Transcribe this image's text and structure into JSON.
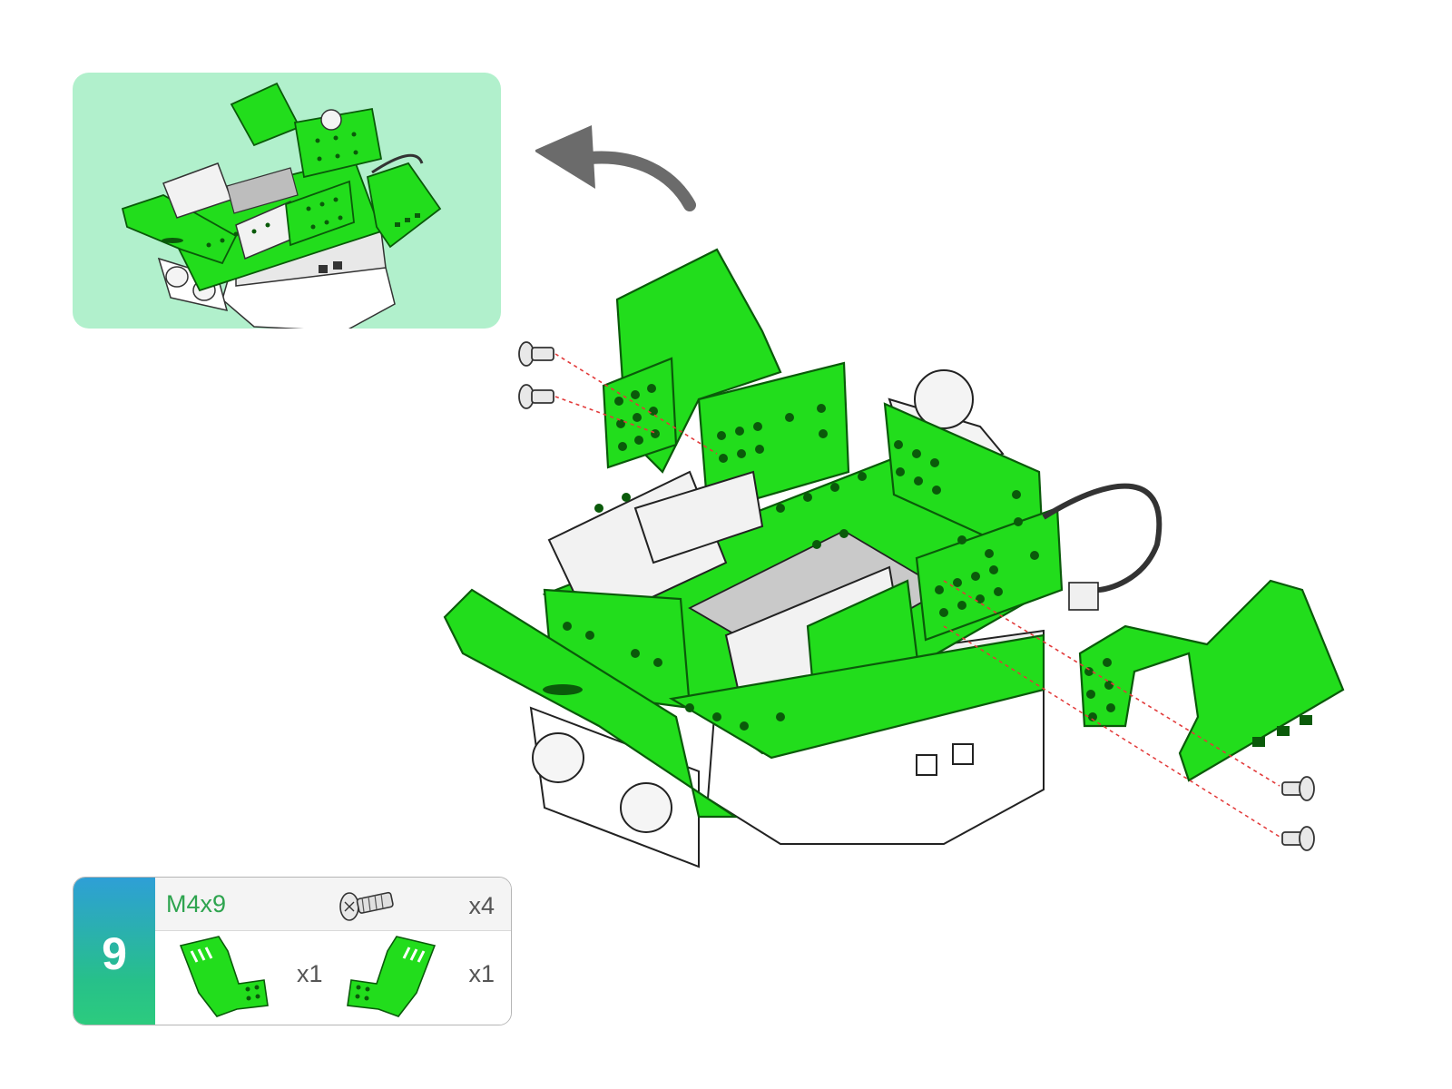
{
  "step": {
    "number": "9"
  },
  "parts": {
    "screw": {
      "label": "M4x9",
      "qty": "x4",
      "icon": "screw-icon"
    },
    "bracket_left": {
      "qty": "x1",
      "icon": "left-side-bracket-icon"
    },
    "bracket_right": {
      "qty": "x1",
      "icon": "right-side-bracket-icon"
    }
  },
  "colors": {
    "part_green": "#22dd1c",
    "part_green_dark": "#11a010",
    "preview_bg": "#b1f0cc",
    "arrow": "#6b6b6b",
    "guide_line": "#e23a3a"
  }
}
